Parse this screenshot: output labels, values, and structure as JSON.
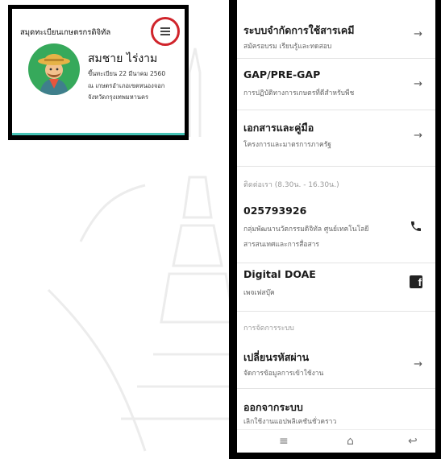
{
  "left_phone": {
    "title": "สมุดทะเบียนเกษตรกรดิจิทัล",
    "name": "สมชาย  ไร่งาม",
    "details": [
      "ขึ้นทะเบียน 22 มีนาคม 2560",
      "ณ เกษตรอำเภอเขตหนองจอก",
      "จังหวัดกรุงเทพมหานคร"
    ],
    "menu_icon": "hamburger-menu-icon",
    "highlight_color": "#d0242b",
    "accent_color": "#46c3b6"
  },
  "right_phone": {
    "items": [
      {
        "title": "ระบบจำกัดการใช้สารเคมี",
        "subtitle": "สมัครอบรม เรียนรู้และทดสอบ"
      },
      {
        "title": "GAP/PRE-GAP",
        "subtitle": "การปฏิบัติทางการเกษตรที่ดีสำหรับพืช"
      },
      {
        "title": "เอกสารและคู่มือ",
        "subtitle": "โครงการและมาตรการภาครัฐ"
      }
    ],
    "contact_header": "ติดต่อเรา (8.30น. - 16.30น.)",
    "phone": {
      "number": "025793926",
      "line1": "กลุ่มพัฒนานวัตกรรมดิจิทัล ศูนย์เทคโนโลยี",
      "line2": "สารสนเทศและการสื่อสาร"
    },
    "facebook": {
      "title": "Digital DOAE",
      "subtitle": "เพจเฟสบุ๊ค"
    },
    "system_header": "การจัดการระบบ",
    "change_password": {
      "title": "เปลี่ยนรหัสผ่าน",
      "subtitle": "จัดการข้อมูลการเข้าใช้งาน"
    },
    "logout": {
      "title": "ออกจากระบบ",
      "subtitle": "เลิกใช้งานแอปพลิเคชันชั่วคราว"
    },
    "arrow": "→",
    "nav": {
      "menu": "≡",
      "home": "⌂",
      "back": "↩"
    }
  }
}
